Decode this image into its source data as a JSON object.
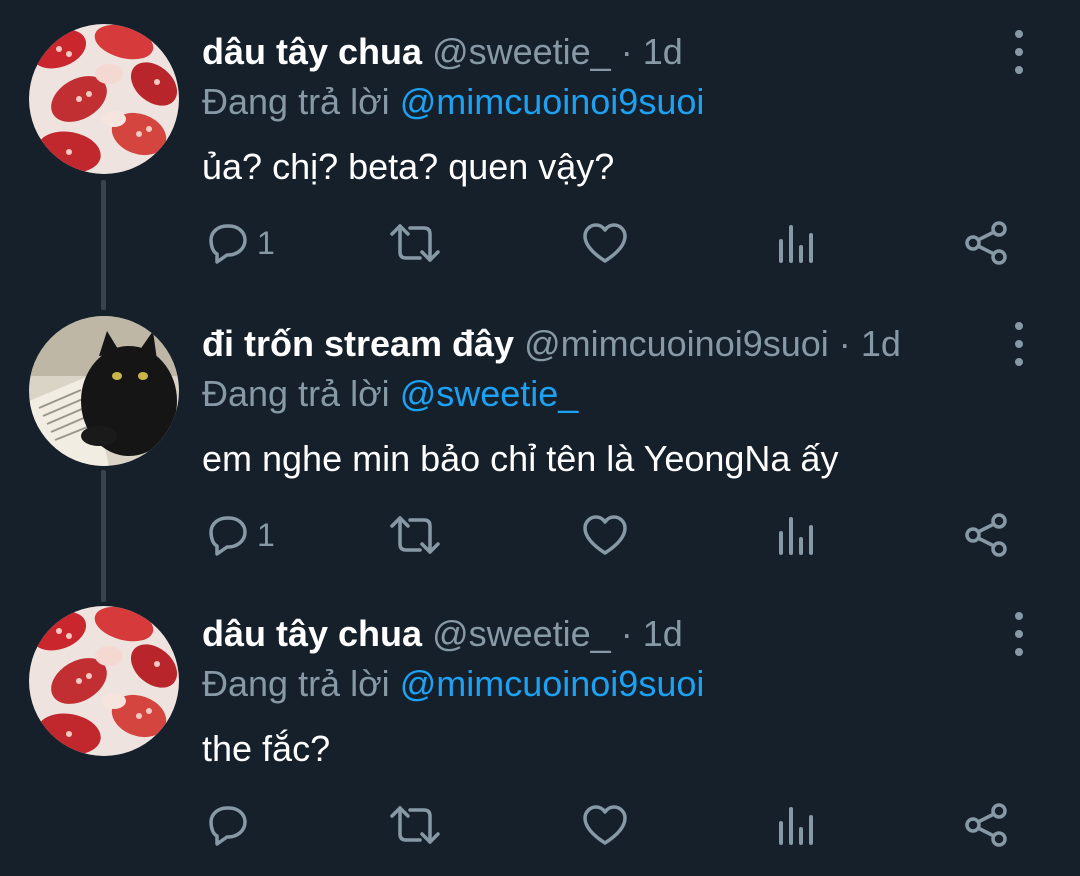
{
  "colors": {
    "background": "#15202b",
    "primary_text": "#ffffff",
    "secondary_text": "#8899a6",
    "link": "#1da1f2",
    "thread_line": "#38444d"
  },
  "tweets": [
    {
      "display_name": "dâu tây chua",
      "handle": "@sweetie_",
      "separator": "·",
      "time": "1d",
      "reply_prefix": "Đang trả lời",
      "reply_to": "@mimcuoinoi9suoi",
      "text": "ủa? chị? beta? quen vậy?",
      "avatar": "strawberry-milk-photo",
      "reply_count": "1"
    },
    {
      "display_name": "đi trốn stream đây",
      "handle": "@mimcuoinoi9suoi",
      "separator": "·",
      "time": "1d",
      "reply_prefix": "Đang trả lời",
      "reply_to": "@sweetie_",
      "text": "em nghe min bảo chỉ tên là YeongNa ấy",
      "avatar": "black-cat-with-book-photo",
      "reply_count": "1"
    },
    {
      "display_name": "dâu tây chua",
      "handle": "@sweetie_",
      "separator": "·",
      "time": "1d",
      "reply_prefix": "Đang trả lời",
      "reply_to": "@mimcuoinoi9suoi",
      "text": "the fắc?",
      "avatar": "strawberry-milk-photo",
      "reply_count": ""
    }
  ],
  "icons": [
    "reply-icon",
    "retweet-icon",
    "like-icon",
    "analytics-icon",
    "share-icon",
    "more-options-icon"
  ]
}
